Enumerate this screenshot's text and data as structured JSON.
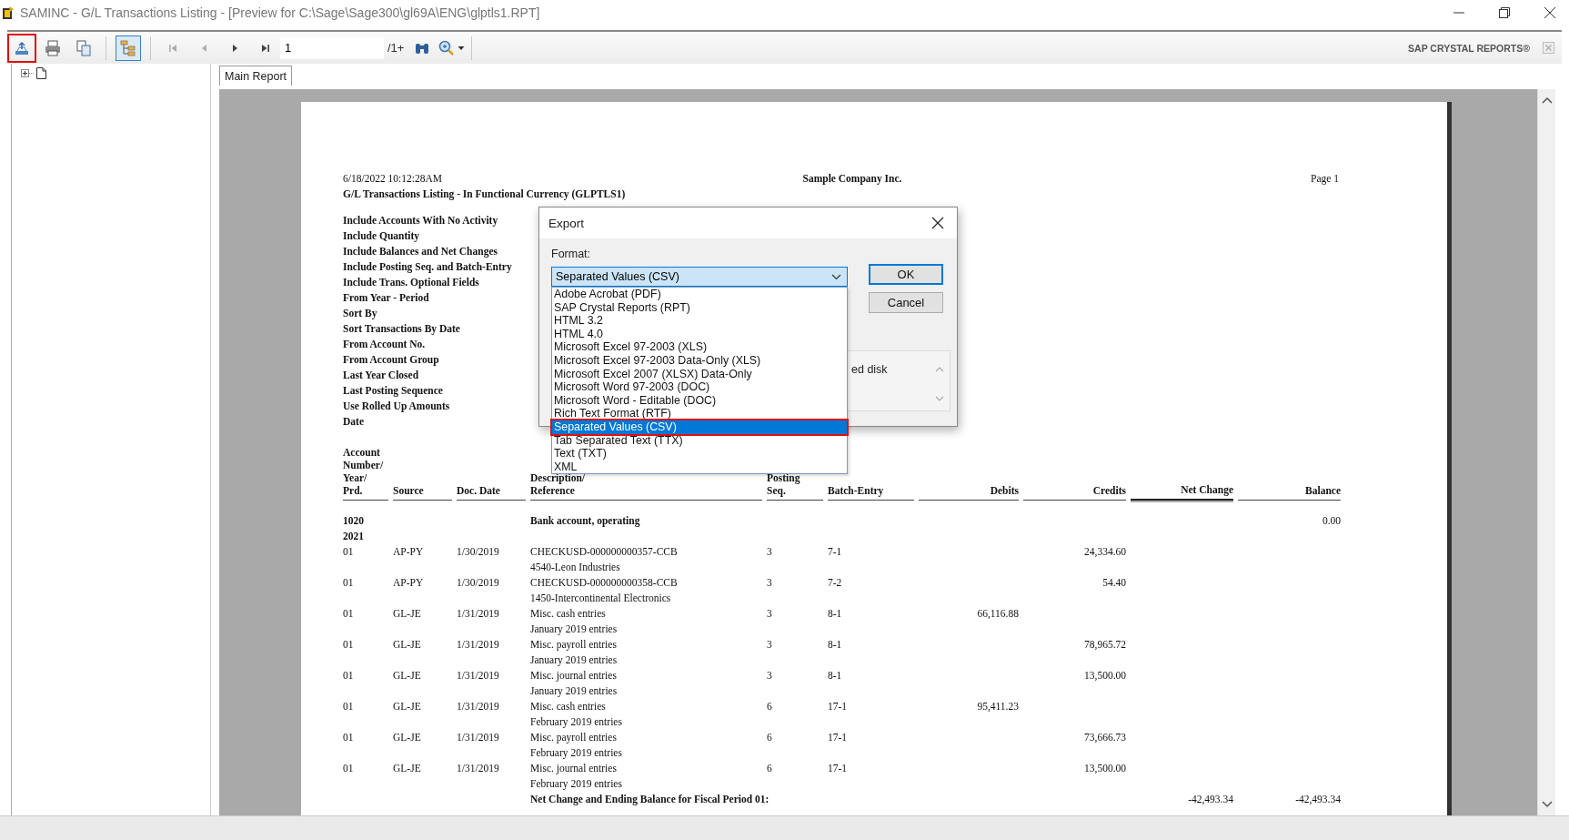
{
  "window": {
    "title": "SAMINC - G/L Transactions Listing - [Preview for C:\\Sage\\Sage300\\gl69A\\ENG\\glptls1.RPT]"
  },
  "toolbar": {
    "tools": [
      {
        "kind": "export",
        "highlighted": true,
        "pressed": false,
        "disabled": false
      },
      {
        "kind": "print",
        "highlighted": false,
        "pressed": false,
        "disabled": false
      },
      {
        "kind": "copy",
        "highlighted": false,
        "pressed": false,
        "disabled": false
      },
      {
        "kind": "tree",
        "highlighted": false,
        "pressed": true,
        "disabled": false
      },
      {
        "kind": "first",
        "highlighted": false,
        "pressed": false,
        "disabled": true
      },
      {
        "kind": "prev",
        "highlighted": false,
        "pressed": false,
        "disabled": true
      },
      {
        "kind": "next",
        "highlighted": false,
        "pressed": false,
        "disabled": false
      },
      {
        "kind": "last",
        "highlighted": false,
        "pressed": false,
        "disabled": false
      }
    ],
    "page_field": {
      "value": "1"
    },
    "page_count": "/1+",
    "tools_right": [
      {
        "kind": "find"
      },
      {
        "kind": "zoom"
      }
    ],
    "brand": "SAP CRYSTAL REPORTS®"
  },
  "tree": {
    "nodes": [
      {
        "expanded": false
      }
    ]
  },
  "tabs": [
    {
      "label": "Main Report",
      "selected": true
    }
  ],
  "report": {
    "printed": "6/18/2022 10:12:28AM",
    "company": "Sample Company Inc.",
    "page": "Page 1",
    "title": "G/L Transactions Listing - In Functional Currency  (GLPTLS1)",
    "parameters": [
      "Include Accounts With No Activity",
      "Include Quantity",
      "Include Balances and Net Changes",
      "Include Posting Seq. and Batch-Entry",
      "Include Trans. Optional Fields",
      "From Year - Period",
      "Sort By",
      "Sort Transactions By Date",
      "From  Account No.",
      "From  Account Group",
      "Last Year Closed",
      "Last Posting Sequence",
      "Use Rolled Up Amounts",
      "Date"
    ],
    "columns": [
      {
        "label": "Account\nNumber/\nYear/\nPrd."
      },
      {
        "label": "Source"
      },
      {
        "label": "Doc. Date"
      },
      {
        "label": "Description/\nReference"
      },
      {
        "label": "Posting\nSeq."
      },
      {
        "label": "Batch-Entry"
      },
      {
        "label": "Debits"
      },
      {
        "label": "Credits"
      },
      {
        "label": "Net Change"
      },
      {
        "label": "Balance"
      }
    ],
    "rows": [
      {
        "kind": "group",
        "account": "1020",
        "year": "2021",
        "description": "Bank account, operating",
        "balance": "0.00"
      },
      {
        "kind": "entry",
        "prd": "01",
        "source": "AP-PY",
        "doc_date": "1/30/2019",
        "description": "CHECKUSD-000000000357-CCB",
        "reference": "4540-Leon Industries",
        "seq": "3",
        "batch": "7-1",
        "credits": "24,334.60"
      },
      {
        "kind": "entry",
        "prd": "01",
        "source": "AP-PY",
        "doc_date": "1/30/2019",
        "description": "CHECKUSD-000000000358-CCB",
        "reference": "1450-Intercontinental Electronics",
        "seq": "3",
        "batch": "7-2",
        "credits": "54.40"
      },
      {
        "kind": "entry",
        "prd": "01",
        "source": "GL-JE",
        "doc_date": "1/31/2019",
        "description": "Misc. cash entries",
        "reference": "January 2019 entries",
        "seq": "3",
        "batch": "8-1",
        "debits": "66,116.88"
      },
      {
        "kind": "entry",
        "prd": "01",
        "source": "GL-JE",
        "doc_date": "1/31/2019",
        "description": "Misc. payroll entries",
        "reference": "January 2019 entries",
        "seq": "3",
        "batch": "8-1",
        "credits": "78,965.72"
      },
      {
        "kind": "entry",
        "prd": "01",
        "source": "GL-JE",
        "doc_date": "1/31/2019",
        "description": "Misc. journal entries",
        "reference": "January 2019 entries",
        "seq": "3",
        "batch": "8-1",
        "credits": "13,500.00"
      },
      {
        "kind": "entry",
        "prd": "01",
        "source": "GL-JE",
        "doc_date": "1/31/2019",
        "description": "Misc. cash entries",
        "reference": "February 2019 entries",
        "seq": "6",
        "batch": "17-1",
        "debits": "95,411.23"
      },
      {
        "kind": "entry",
        "prd": "01",
        "source": "GL-JE",
        "doc_date": "1/31/2019",
        "description": "Misc. payroll entries",
        "reference": "February 2019 entries",
        "seq": "6",
        "batch": "17-1",
        "credits": "73,666.73"
      },
      {
        "kind": "entry",
        "prd": "01",
        "source": "GL-JE",
        "doc_date": "1/31/2019",
        "description": "Misc. journal entries",
        "reference": "February 2019 entries",
        "seq": "6",
        "batch": "17-1",
        "credits": "13,500.00"
      },
      {
        "kind": "total",
        "description": "Net Change and Ending Balance for Fiscal Period 01:",
        "net_change": "-42,493.34",
        "balance": "-42,493.34"
      }
    ]
  },
  "dialog": {
    "title": "Export",
    "format_label": "Format:",
    "format_value": "Separated Values (CSV)",
    "options": [
      {
        "label": "Adobe Acrobat (PDF)",
        "selected": false,
        "highlighted": false
      },
      {
        "label": "SAP Crystal Reports (RPT)",
        "selected": false,
        "highlighted": false
      },
      {
        "label": "HTML 3.2",
        "selected": false,
        "highlighted": false
      },
      {
        "label": "HTML 4.0",
        "selected": false,
        "highlighted": false
      },
      {
        "label": "Microsoft Excel 97-2003 (XLS)",
        "selected": false,
        "highlighted": false
      },
      {
        "label": "Microsoft Excel 97-2003 Data-Only (XLS)",
        "selected": false,
        "highlighted": false
      },
      {
        "label": "Microsoft Excel 2007 (XLSX) Data-Only",
        "selected": false,
        "highlighted": false
      },
      {
        "label": "Microsoft Word 97-2003 (DOC)",
        "selected": false,
        "highlighted": false
      },
      {
        "label": "Microsoft Word - Editable (DOC)",
        "selected": false,
        "highlighted": false
      },
      {
        "label": "Rich Text Format (RTF)",
        "selected": false,
        "highlighted": false
      },
      {
        "label": "Separated Values (CSV)",
        "selected": true,
        "highlighted": true
      },
      {
        "label": "Tab Separated Text (TTX)",
        "selected": false,
        "highlighted": false
      },
      {
        "label": "Text (TXT)",
        "selected": false,
        "highlighted": false
      },
      {
        "label": "XML",
        "selected": false,
        "highlighted": false
      }
    ],
    "destination_text": "ed disk",
    "buttons": [
      {
        "label": "OK",
        "default": true
      },
      {
        "label": "Cancel",
        "default": false
      }
    ]
  }
}
